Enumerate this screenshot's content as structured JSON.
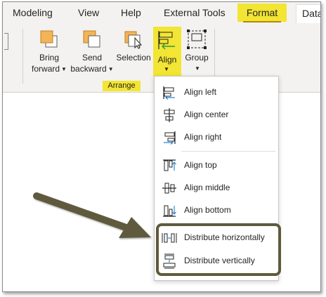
{
  "tabs": {
    "modeling": "Modeling",
    "view": "View",
    "help": "Help",
    "external_tools": "External Tools",
    "format": "Format",
    "data": "Data"
  },
  "ribbon": {
    "bring_forward": [
      "Bring",
      "forward"
    ],
    "send_backward": [
      "Send",
      "backward"
    ],
    "selection": "Selection",
    "align": "Align",
    "group": "Group",
    "group_label": "Arrange"
  },
  "align_menu": {
    "items": [
      {
        "label": "Align left",
        "icon": "align-left-icon"
      },
      {
        "label": "Align center",
        "icon": "align-center-icon"
      },
      {
        "label": "Align right",
        "icon": "align-right-icon"
      },
      {
        "label": "Align top",
        "icon": "align-top-icon"
      },
      {
        "label": "Align middle",
        "icon": "align-middle-icon"
      },
      {
        "label": "Align bottom",
        "icon": "align-bottom-icon"
      },
      {
        "label": "Distribute horizontally",
        "icon": "distribute-horizontally-icon"
      },
      {
        "label": "Distribute vertically",
        "icon": "distribute-vertically-icon"
      }
    ]
  },
  "colors": {
    "highlight_yellow": "#f2e533",
    "callout_arrow": "#5f5a3c",
    "icon_blue": "#2b88d8",
    "icon_orange": "#f2b457"
  }
}
